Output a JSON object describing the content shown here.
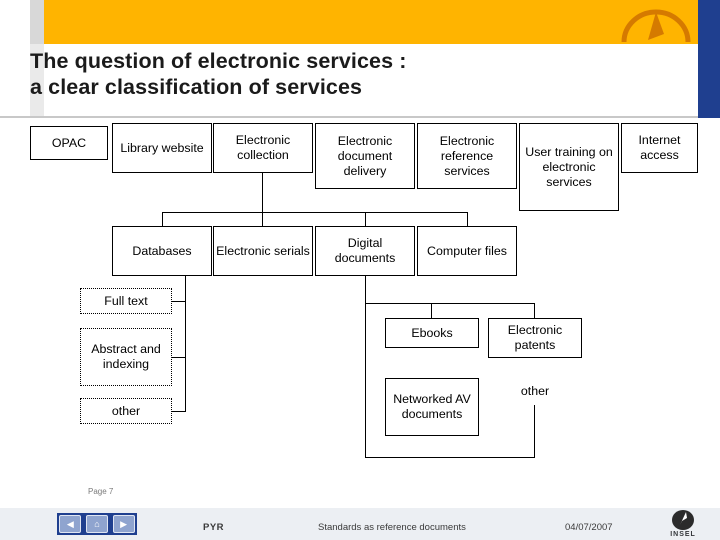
{
  "slide": {
    "title_line1": "The question of electronic services :",
    "title_line2": "a clear classification of services"
  },
  "diagram": {
    "row1": [
      {
        "label": "OPAC"
      },
      {
        "label": "Library website"
      },
      {
        "label": "Electronic collection"
      },
      {
        "label": "Electronic document delivery"
      },
      {
        "label": "Electronic reference services"
      },
      {
        "label": "User training on electronic services"
      },
      {
        "label": "Internet access"
      }
    ],
    "row2": [
      {
        "label": "Databases"
      },
      {
        "label": "Electronic serials"
      },
      {
        "label": "Digital documents"
      },
      {
        "label": "Computer files"
      }
    ],
    "row3_left": [
      {
        "label": "Full text"
      },
      {
        "label": "Abstract and indexing"
      },
      {
        "label": "other"
      }
    ],
    "row3_right": [
      {
        "label": "Ebooks"
      },
      {
        "label": "Electronic patents"
      },
      {
        "label": "Networked AV documents"
      },
      {
        "label": "other"
      }
    ]
  },
  "footer": {
    "page_label": "Page 7",
    "author": "PYR",
    "center": "Standards as reference documents",
    "date": "04/07/2007",
    "logo_text": "INSEL",
    "nav_prev": "◀",
    "nav_home": "⌂",
    "nav_next": "▶"
  },
  "colors": {
    "banner": "#ffb400",
    "accent_blue": "#1f3f8f",
    "footer_bg": "#eceff3"
  }
}
